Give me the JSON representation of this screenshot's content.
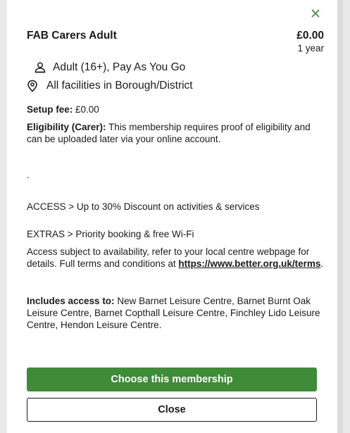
{
  "modal": {
    "title": "FAB Carers Adult",
    "price": "£0.00",
    "period": "1 year",
    "audience": "Adult (16+), Pay As You Go",
    "facilities": "All facilities in Borough/District",
    "setup_fee_label": "Setup fee:",
    "setup_fee_value": "£0.00",
    "eligibility_label": "Eligibility (Carer):",
    "eligibility_text": "This membership requires proof of eligibility and can be uploaded later via your online account.",
    "dot": ".",
    "access_text": "ACCESS > Up to 30% Discount on activities & services",
    "extras_text": "EXTRAS > Priority booking & free Wi-Fi",
    "terms_text": "Access subject to availability, refer to your local centre webpage for details. Full terms and conditions at",
    "terms_link": "https://www.better.org.uk/terms",
    "terms_end": ".",
    "includes_label": "Includes access to:",
    "includes_text": "New Barnet Leisure Centre, Barnet Burnt Oak Leisure Centre, Barnet Copthall Leisure Centre, Finchley Lido Leisure Centre, Hendon Leisure Centre.",
    "choose_button": "Choose this membership",
    "close_button": "Close"
  },
  "icons": {
    "close": "close-icon",
    "person": "person-icon",
    "location": "location-pin-icon"
  },
  "colors": {
    "accent_green": "#3f8b38",
    "text": "#1b1b1b"
  }
}
